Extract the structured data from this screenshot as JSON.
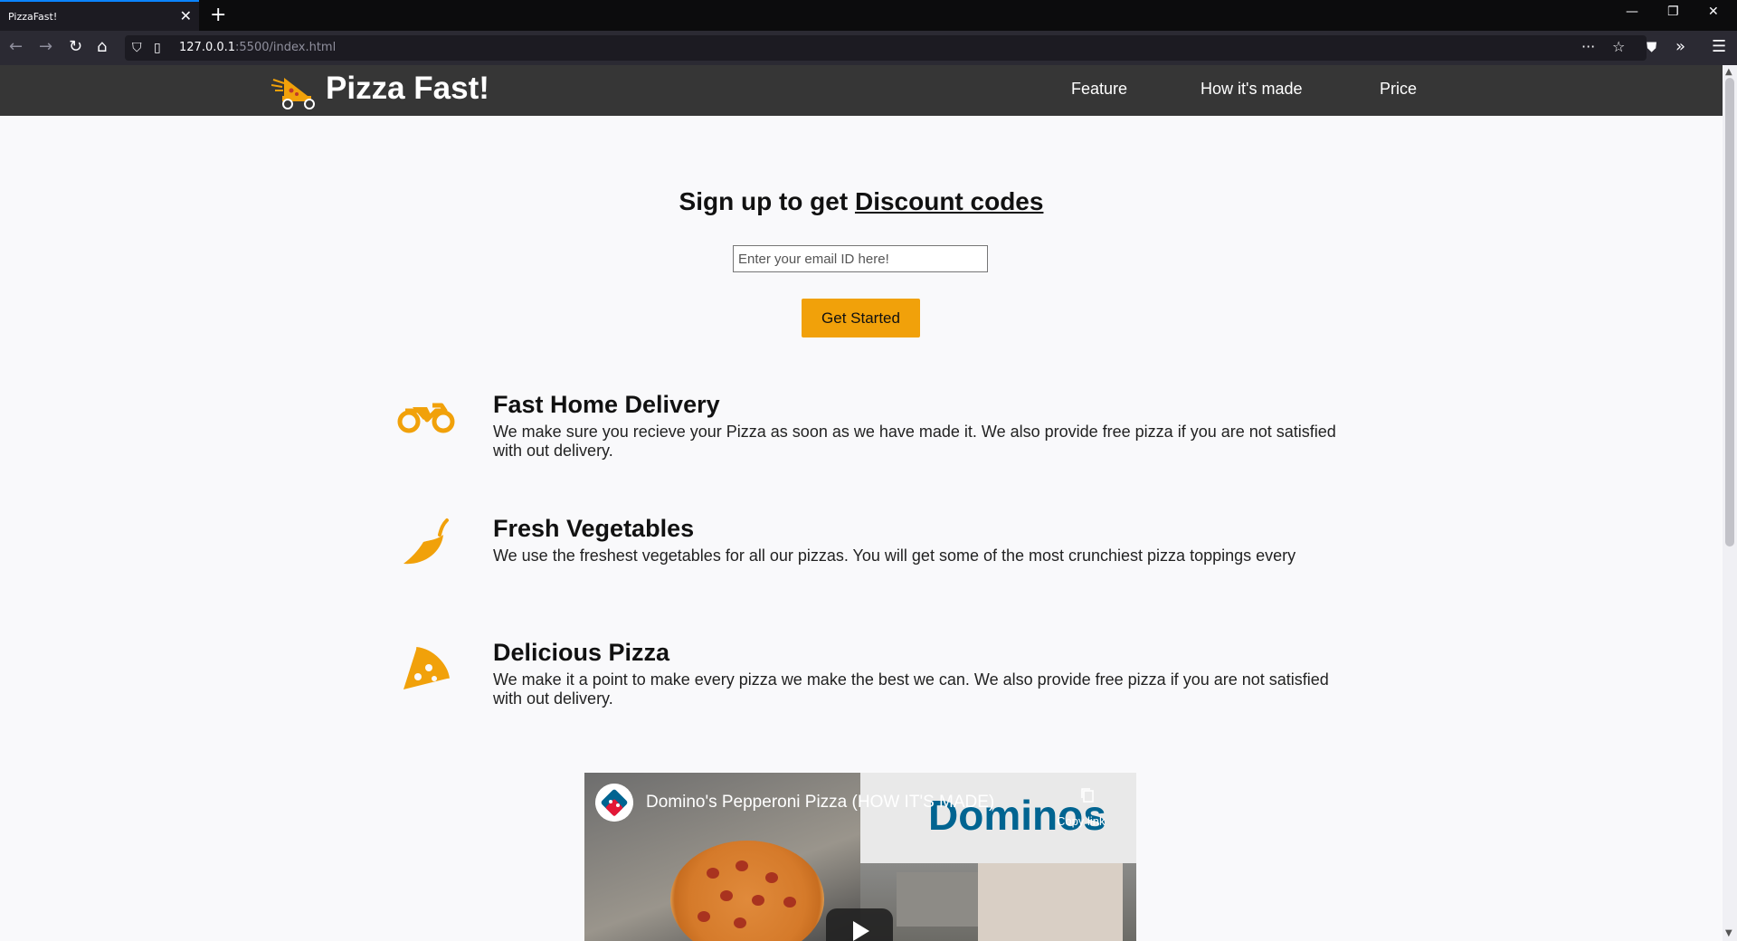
{
  "browser": {
    "tab_title": "PizzaFast!",
    "url_host": "127.0.0.1",
    "url_path": ":5500/index.html"
  },
  "header": {
    "brand": "Pizza Fast!",
    "nav": [
      "Feature",
      "How it's made",
      "Price"
    ]
  },
  "signup": {
    "headline_prefix": "Sign up to get",
    "headline_link": "Discount codes",
    "email_placeholder": "Enter your email ID here!",
    "cta_label": "Get Started"
  },
  "features": [
    {
      "icon": "motorcycle-icon",
      "title": "Fast Home Delivery",
      "desc": "We make sure you recieve your Pizza as soon as we have made it. We also provide free pizza if you are not satisfied with out delivery."
    },
    {
      "icon": "pepper-icon",
      "title": "Fresh Vegetables",
      "desc": "We use the freshest vegetables for all our pizzas. You will get some of the most crunchiest pizza toppings every"
    },
    {
      "icon": "pizza-slice-icon",
      "title": "Delicious Pizza",
      "desc": "We make it a point to make every pizza we make the best we can. We also provide free pizza if you are not satisfied with out delivery."
    }
  ],
  "video": {
    "title": "Domino's Pepperoni Pizza (HOW IT'S MADE)",
    "copy_link": "Copy link",
    "overlay_brand": "Dominos"
  },
  "colors": {
    "accent": "#f1a10a",
    "header_bg": "#363636",
    "page_bg": "#f9f9fb"
  }
}
